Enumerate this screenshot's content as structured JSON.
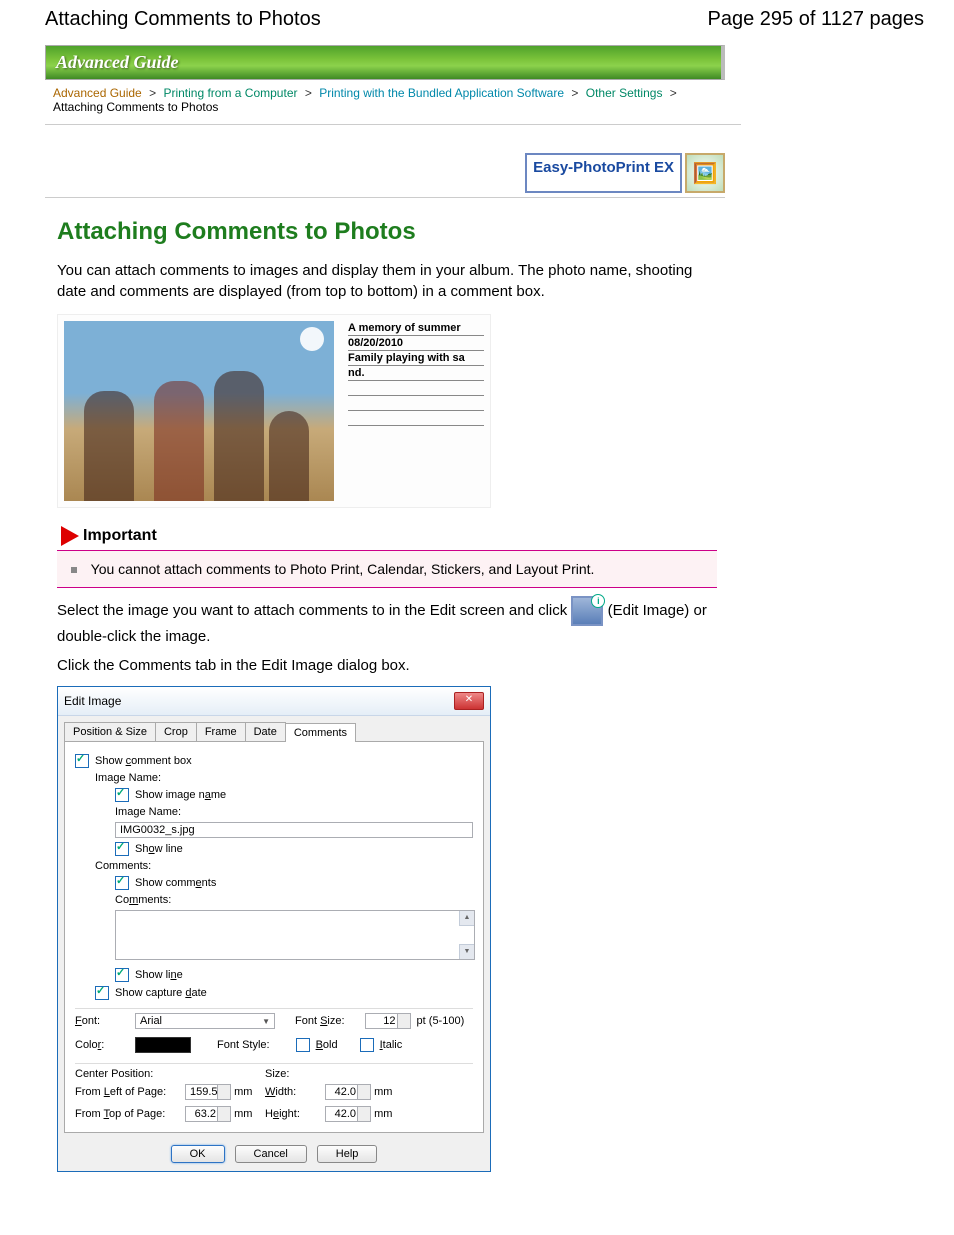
{
  "header": {
    "title": "Attaching Comments to Photos",
    "page_info": "Page 295 of 1127 pages"
  },
  "banner": "Advanced Guide",
  "breadcrumb": {
    "b0": "Advanced Guide",
    "b1": "Printing from a Computer",
    "b2": "Printing with the Bundled Application Software",
    "b3": "Other Settings",
    "leaf": "Attaching Comments to Photos"
  },
  "logo": "Easy-PhotoPrint EX",
  "page_title": "Attaching Comments to Photos",
  "para1": "You can attach comments to images and display them in your album. The photo name, shooting date and comments are displayed (from top to bottom) in a comment box.",
  "sample": {
    "title": "A memory of summer",
    "date": "08/20/2010",
    "line1": "Family playing with sa",
    "line2": "nd."
  },
  "important": {
    "label": "Important",
    "text": "You cannot attach comments to Photo Print, Calendar, Stickers, and Layout Print."
  },
  "para2a": "Select the image you want to attach comments to in the Edit screen and click ",
  "para2b": " (Edit Image) or double-click the image.",
  "para3": "Click the Comments tab in the Edit Image dialog box.",
  "dlg": {
    "title": "Edit Image",
    "tabs": {
      "t0": "Position & Size",
      "t1": "Crop",
      "t2": "Frame",
      "t3": "Date",
      "t4": "Comments"
    },
    "show_comment_box": "Show comment box",
    "image_name_hdr": "Image Name:",
    "show_image_name": "Show image name",
    "image_name_lbl": "Image Name:",
    "image_name_val": "IMG0032_s.jpg",
    "show_line1": "Show line",
    "comments_hdr": "Comments:",
    "show_comments": "Show comments",
    "comments_lbl": "Comments:",
    "show_line2": "Show line",
    "show_capture_date": "Show capture date",
    "font_lbl": "Font:",
    "font_val": "Arial",
    "font_size_lbl": "Font Size:",
    "font_size_val": "12",
    "font_size_suffix": "pt (5-100)",
    "color_lbl": "Color:",
    "font_style_lbl": "Font Style:",
    "bold": "Bold",
    "italic": "Italic",
    "center_pos": "Center Position:",
    "size": "Size:",
    "from_left": "From Left of Page:",
    "from_left_val": "159.5",
    "width": "Width:",
    "width_val": "42.0",
    "from_top": "From Top of Page:",
    "from_top_val": "63.2",
    "height": "Height:",
    "height_val": "42.0",
    "mm": "mm",
    "ok": "OK",
    "cancel": "Cancel",
    "help": "Help"
  }
}
